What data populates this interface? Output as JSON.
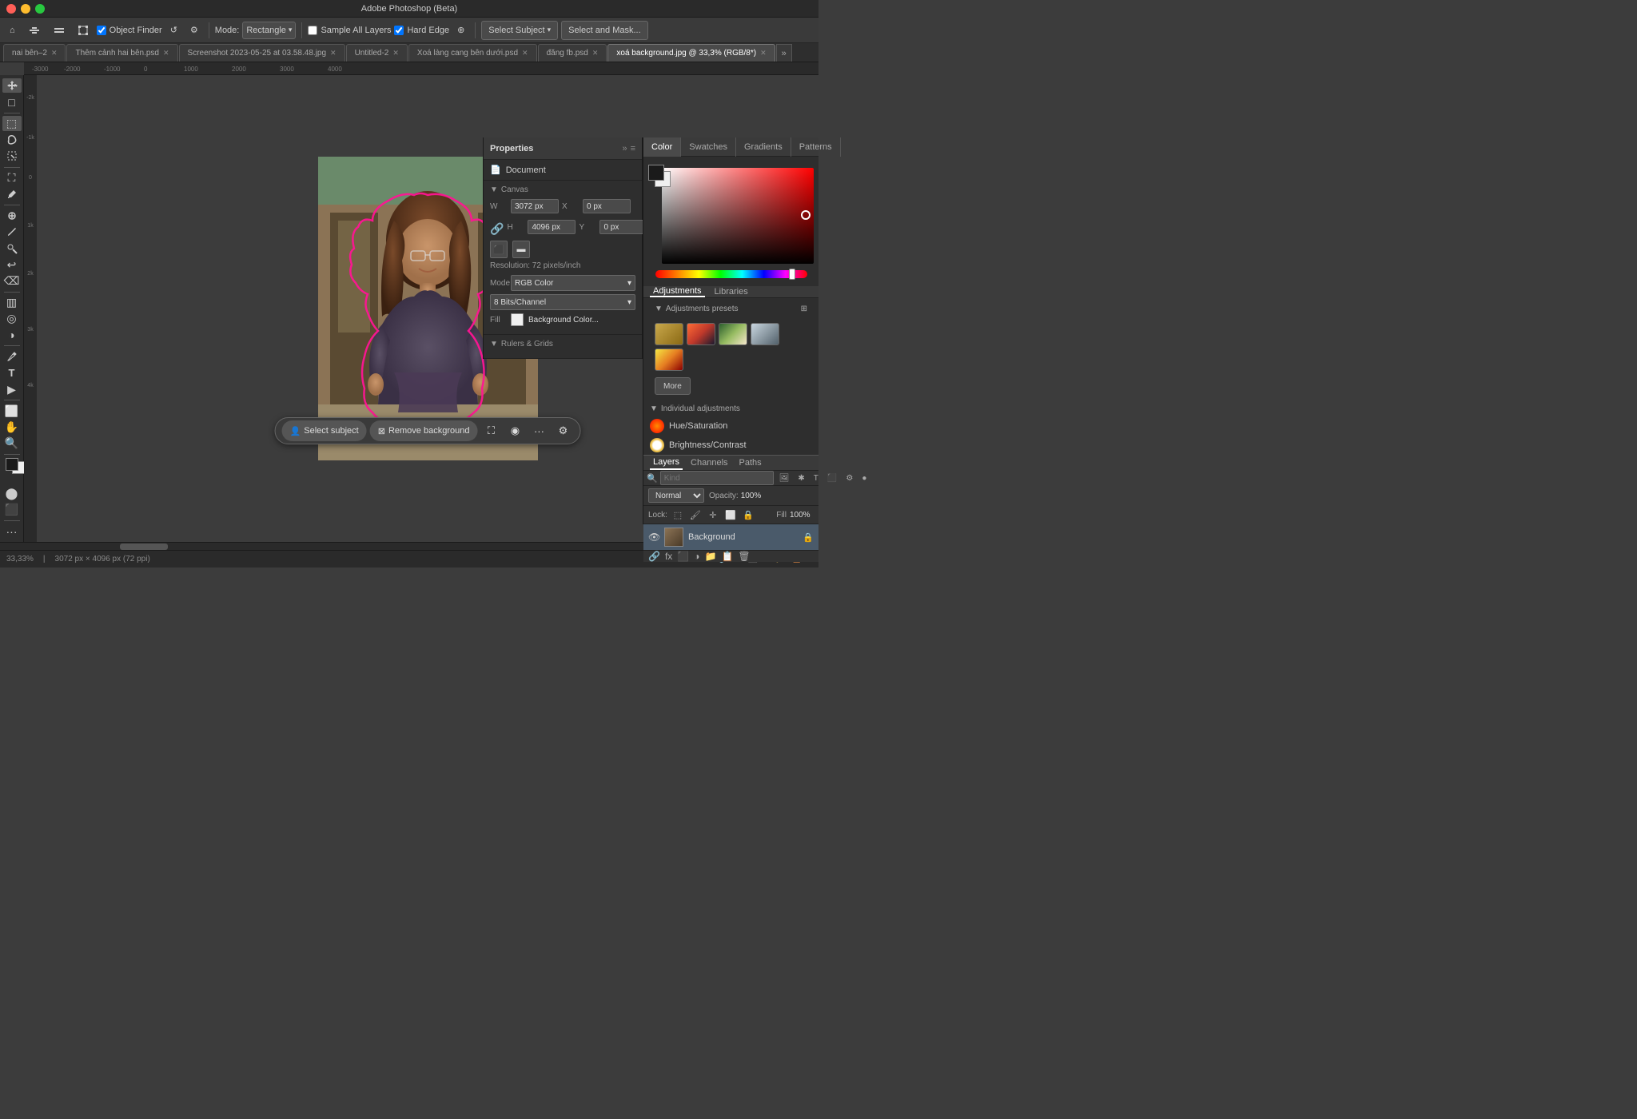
{
  "app": {
    "title": "Adobe Photoshop (Beta)",
    "traffic_lights": [
      "close",
      "minimize",
      "maximize"
    ]
  },
  "toolbar": {
    "mode_label": "Mode:",
    "mode_value": "Rectangle",
    "sample_all_label": "Sample All Layers",
    "hard_edge_label": "Hard Edge",
    "select_subject_label": "Select Subject",
    "select_mask_label": "Select and Mask...",
    "object_finder_label": "Object Finder"
  },
  "tabs": [
    {
      "label": "nai bên–2",
      "active": false
    },
    {
      "label": "Thêm cảnh hai bên.psd",
      "active": false
    },
    {
      "label": "Screenshot 2023-05-25 at 03.58.48.jpg",
      "active": false
    },
    {
      "label": "Untitled-2",
      "active": false
    },
    {
      "label": "Xoá làng cang bên dưới.psd",
      "active": false
    },
    {
      "label": "đăng fb.psd",
      "active": false
    },
    {
      "label": "xoá background.jpg @ 33,3% (RGB/8*)",
      "active": true
    }
  ],
  "properties": {
    "title": "Properties",
    "document_label": "Document",
    "canvas_label": "Canvas",
    "width_label": "W",
    "width_value": "3072 px",
    "height_label": "H",
    "height_value": "4096 px",
    "x_label": "X",
    "x_value": "0 px",
    "y_label": "Y",
    "y_value": "0 px",
    "resolution_label": "Resolution: 72 pixels/inch",
    "mode_label": "Mode",
    "mode_value": "RGB Color",
    "bits_label": "8 Bits/Channel",
    "fill_label": "Fill",
    "fill_value": "Background Color...",
    "rulers_grids_label": "Rulers & Grids"
  },
  "color_panel": {
    "tabs": [
      "Color",
      "Swatches",
      "Gradients",
      "Patterns"
    ]
  },
  "adjustments": {
    "tabs": [
      "Adjustments",
      "Libraries"
    ],
    "presets_title": "Adjustments presets",
    "more_label": "More",
    "individual_title": "Individual adjustments",
    "items": [
      {
        "label": "Hue/Saturation"
      },
      {
        "label": "Brightness/Contrast"
      }
    ]
  },
  "layers": {
    "tabs": [
      "Layers",
      "Channels",
      "Paths"
    ],
    "search_placeholder": "Kind",
    "blend_mode": "Normal",
    "opacity_label": "Opacity:",
    "opacity_value": "100%",
    "fill_label": "Fill",
    "fill_value": "100%",
    "lock_label": "Lock:",
    "items": [
      {
        "name": "Background",
        "visible": true,
        "locked": true
      }
    ]
  },
  "floating_toolbar": {
    "select_subject_label": "Select subject",
    "remove_bg_label": "Remove background"
  },
  "status_bar": {
    "zoom": "33,33%",
    "dimensions": "3072 px × 4096 px (72 ppi)"
  }
}
